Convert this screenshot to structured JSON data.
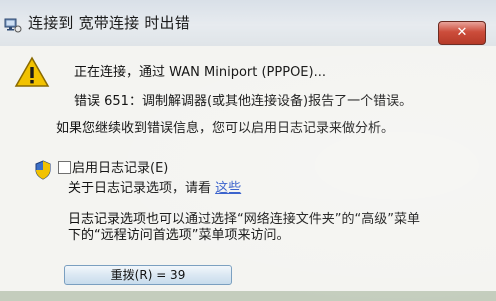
{
  "window": {
    "title": "连接到 宽带连接 时出错",
    "close_glyph": "✕"
  },
  "message": {
    "status": "正在连接，通过 WAN Miniport (PPPOE)...",
    "error": "错误 651：调制解调器(或其他连接设备)报告了一个错误。",
    "hint": "如果您继续收到错误信息，您可以启用日志记录来做分析。"
  },
  "logging": {
    "checkbox_label": "启用日志记录(E)",
    "about_text": "关于日志记录选项，请看",
    "link_text": "这些",
    "note_line1": "日志记录选项也可以通过选择“网络连接文件夹”的“高级”菜单",
    "note_line2": "下的“远程访问首选项”菜单项来访问。"
  },
  "buttons": {
    "retry_label": "重拨(R) = 39"
  },
  "colors": {
    "close_button": "#c8412e",
    "link": "#2a55c8",
    "warning": "#f2c200"
  },
  "icons": {
    "title": "network-connection-icon",
    "warning": "warning-icon",
    "shield": "uac-shield-icon",
    "close": "close-icon"
  }
}
